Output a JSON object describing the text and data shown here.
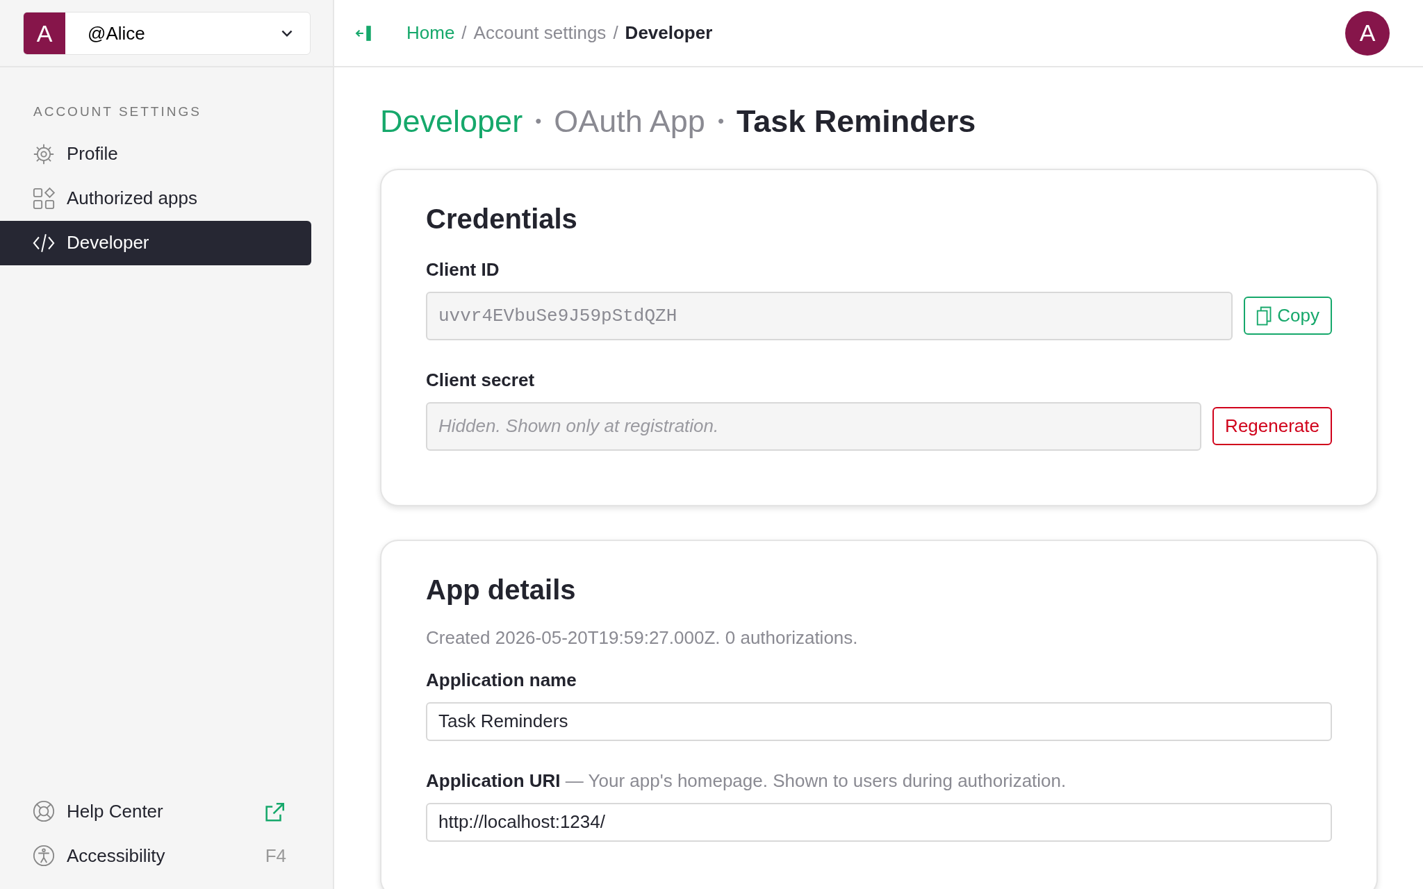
{
  "account_switcher": {
    "avatar": "A",
    "name": "@Alice"
  },
  "breadcrumb": [
    {
      "kind": "link",
      "label": "Home"
    },
    {
      "kind": "separator",
      "label": "/"
    },
    {
      "kind": "muted",
      "label": "Account settings"
    },
    {
      "kind": "separator",
      "label": "/"
    },
    {
      "kind": "current",
      "label": "Developer"
    }
  ],
  "user_avatar": "A",
  "sidebar": {
    "heading": "ACCOUNT SETTINGS",
    "items": [
      {
        "label": "Profile",
        "selected": false
      },
      {
        "label": "Authorized apps",
        "selected": false
      },
      {
        "label": "Developer",
        "selected": true
      }
    ],
    "footer": [
      {
        "label": "Help Center",
        "kind": "external"
      },
      {
        "label": "Accessibility",
        "kind": "shortcut",
        "shortcut": "F4"
      }
    ]
  },
  "page_title": [
    {
      "kind": "link",
      "label": "Developer"
    },
    {
      "kind": "separator",
      "label": "•"
    },
    {
      "kind": "muted",
      "label": "OAuth App"
    },
    {
      "kind": "separator",
      "label": "•"
    },
    {
      "kind": "current",
      "label": "Task Reminders"
    }
  ],
  "cards": [
    {
      "title": "Credentials",
      "fields": [
        {
          "label": "Client ID",
          "kind": "code",
          "disabled": true,
          "value": "uvvr4EVbuSe9J59pStdQZH",
          "button": {
            "kind": "copy",
            "label": "Copy"
          }
        },
        {
          "label": "Client secret",
          "kind": "text",
          "disabled": true,
          "placeholder": "Hidden. Shown only at registration.",
          "button": {
            "kind": "danger",
            "label": "Regenerate"
          }
        }
      ]
    },
    {
      "title": "App details",
      "note": "Created 2026-05-20T19:59:27.000Z. 0 authorizations.",
      "fields": [
        {
          "label": "Application name",
          "kind": "text",
          "disabled": false,
          "value": "Task Reminders"
        },
        {
          "label": "Application URI",
          "hint": "— Your app's homepage. Shown to users during authorization.",
          "kind": "text",
          "disabled": false,
          "value": "http://localhost:1234/"
        }
      ]
    }
  ]
}
